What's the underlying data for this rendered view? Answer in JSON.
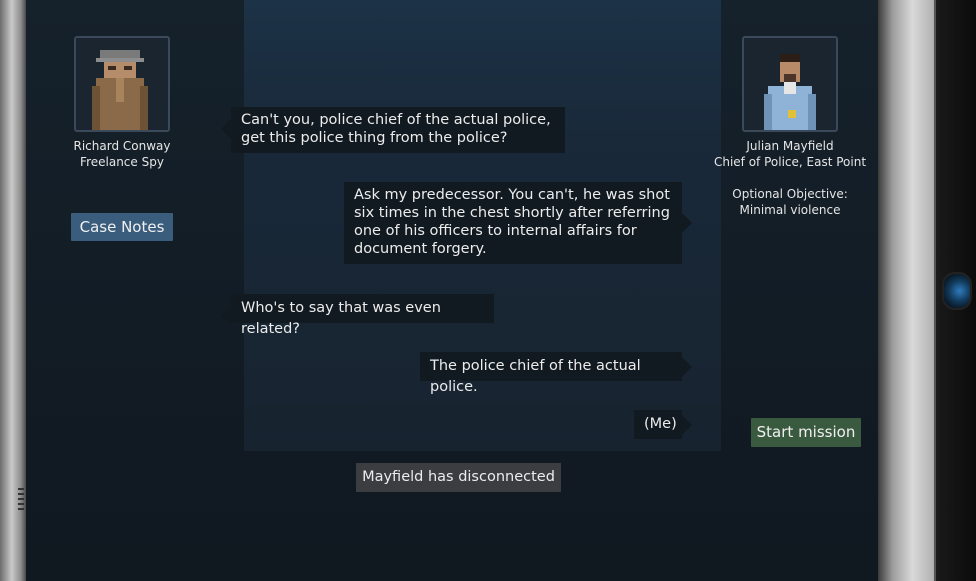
{
  "left_person": {
    "name": "Richard Conway",
    "title": "Freelance Spy"
  },
  "right_person": {
    "name": "Julian Mayfield",
    "title": "Chief of Police, East Point",
    "objective_label": "Optional Objective:",
    "objective": "Minimal violence"
  },
  "buttons": {
    "case_notes": "Case Notes",
    "start_mission": "Start mission"
  },
  "messages": [
    {
      "side": "left",
      "text": "Can't you, police chief of the actual police, get this police thing from the police?"
    },
    {
      "side": "right",
      "text": "Ask my predecessor. You can't, he was shot six times in the chest shortly after referring one of his officers to internal affairs for document forgery."
    },
    {
      "side": "left",
      "text": "Who's to say that was even related?"
    },
    {
      "side": "right",
      "text": "The police chief of the actual police."
    },
    {
      "side": "right",
      "text": "(Me)"
    }
  ],
  "status": "Mayfield has disconnected",
  "colors": {
    "panel": "#15212b",
    "chat": "#19293a",
    "bubble": "#121a21",
    "case_notes": "#3b5d7d",
    "start": "#3a5a3f"
  }
}
